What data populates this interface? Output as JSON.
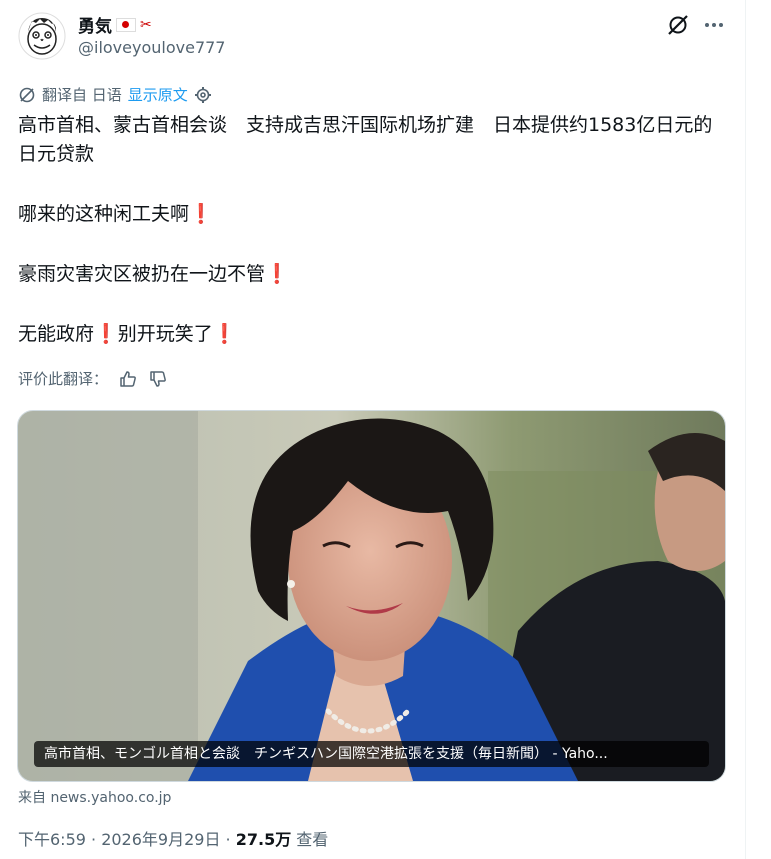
{
  "author": {
    "display_name": "勇気",
    "handle": "@iloveyoulove777"
  },
  "translation": {
    "label": "翻译自 日语",
    "show_original": "显示原文"
  },
  "post": {
    "line1": "高市首相、蒙古首相会谈　支持成吉思汗国际机场扩建　日本提供约1583亿日元的日元贷款",
    "line2": "哪来的这种闲工夫啊",
    "line3": "豪雨灾害灾区被扔在一边不管",
    "line4a": "无能政府",
    "line4b": "别开玩笑了",
    "bang": "❗"
  },
  "rate_translation": "评价此翻译：",
  "card": {
    "caption": "高市首相、モンゴル首相と会談　チンギスハン国際空港拡張を支援（毎日新聞） - Yaho...",
    "source": "来自 news.yahoo.co.jp"
  },
  "meta": {
    "time_date": "下午6:59 · 2026年9月29日 · ",
    "views": "27.5万",
    "views_label": " 查看"
  },
  "icons": {
    "grok": "grok-icon",
    "more": "more-horizontal-icon",
    "translate": "translate-icon",
    "settings": "gear-icon",
    "thumb_up": "thumbs-up-icon",
    "thumb_down": "thumbs-down-icon"
  }
}
